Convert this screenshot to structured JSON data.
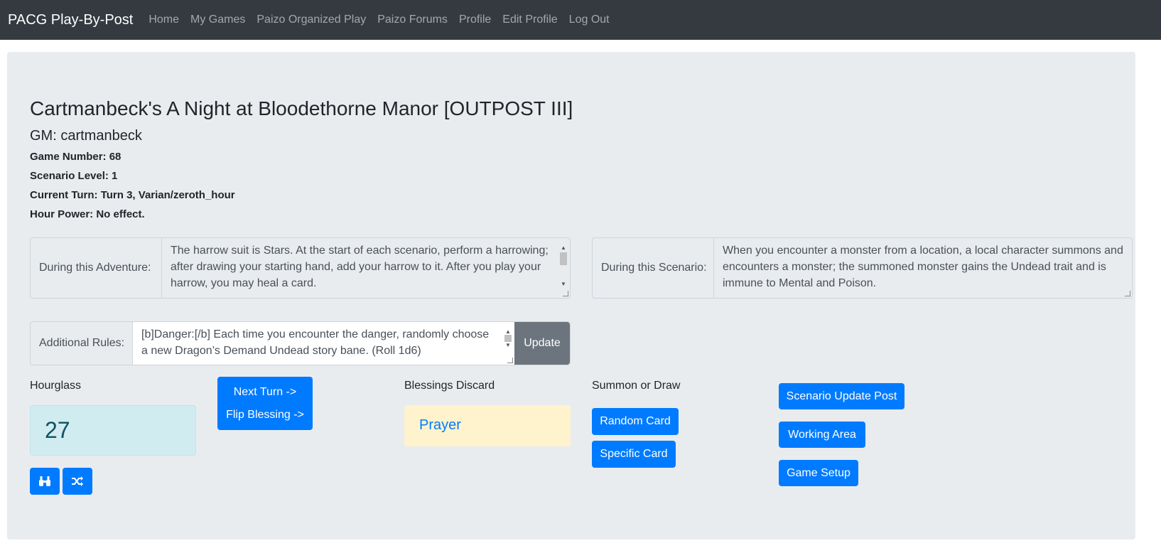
{
  "nav": {
    "brand": "PACG Play-By-Post",
    "links": [
      "Home",
      "My Games",
      "Paizo Organized Play",
      "Paizo Forums",
      "Profile",
      "Edit Profile",
      "Log Out"
    ]
  },
  "game": {
    "title": "Cartmanbeck's A Night at Bloodethorne Manor [OUTPOST III]",
    "gm": "GM: cartmanbeck",
    "number": "Game Number: 68",
    "scenario_level": "Scenario Level: 1",
    "current_turn": "Current Turn: Turn 3, Varian/zeroth_hour",
    "hour_power": "Hour Power: No effect."
  },
  "adventure": {
    "label": "During this Adventure:",
    "text": "The harrow suit is Stars. At the start of each scenario, perform a harrowing; after drawing your starting hand, add your harrow to it. After you play your harrow, you may heal a card."
  },
  "scenario": {
    "label": "During this Scenario:",
    "text": "When you encounter a monster from a location, a local character summons and encounters a monster; the summoned monster gains the Undead trait and is immune to Mental and Poison."
  },
  "additional": {
    "label": "Additional Rules:",
    "text": "[b]Danger:[/b] Each time you encounter the danger, randomly choose a new Dragon’s Demand Undead story bane. (Roll 1d6)",
    "update_label": "Update"
  },
  "hourglass": {
    "label": "Hourglass",
    "value": "27",
    "icons": [
      "binoculars-icon",
      "shuffle-icon"
    ]
  },
  "turn_buttons": {
    "next_turn": "Next Turn ->",
    "flip_blessing": "Flip Blessing ->"
  },
  "blessings": {
    "label": "Blessings Discard",
    "card": "Prayer"
  },
  "summon": {
    "label": "Summon or Draw",
    "random": "Random Card",
    "specific": "Specific Card"
  },
  "actions": {
    "scenario_update": "Scenario Update Post",
    "working_area": "Working Area",
    "game_setup": "Game Setup"
  },
  "colors": {
    "primary": "#007bff",
    "navbar": "#343a40",
    "jumbotron": "#e9ecef"
  }
}
